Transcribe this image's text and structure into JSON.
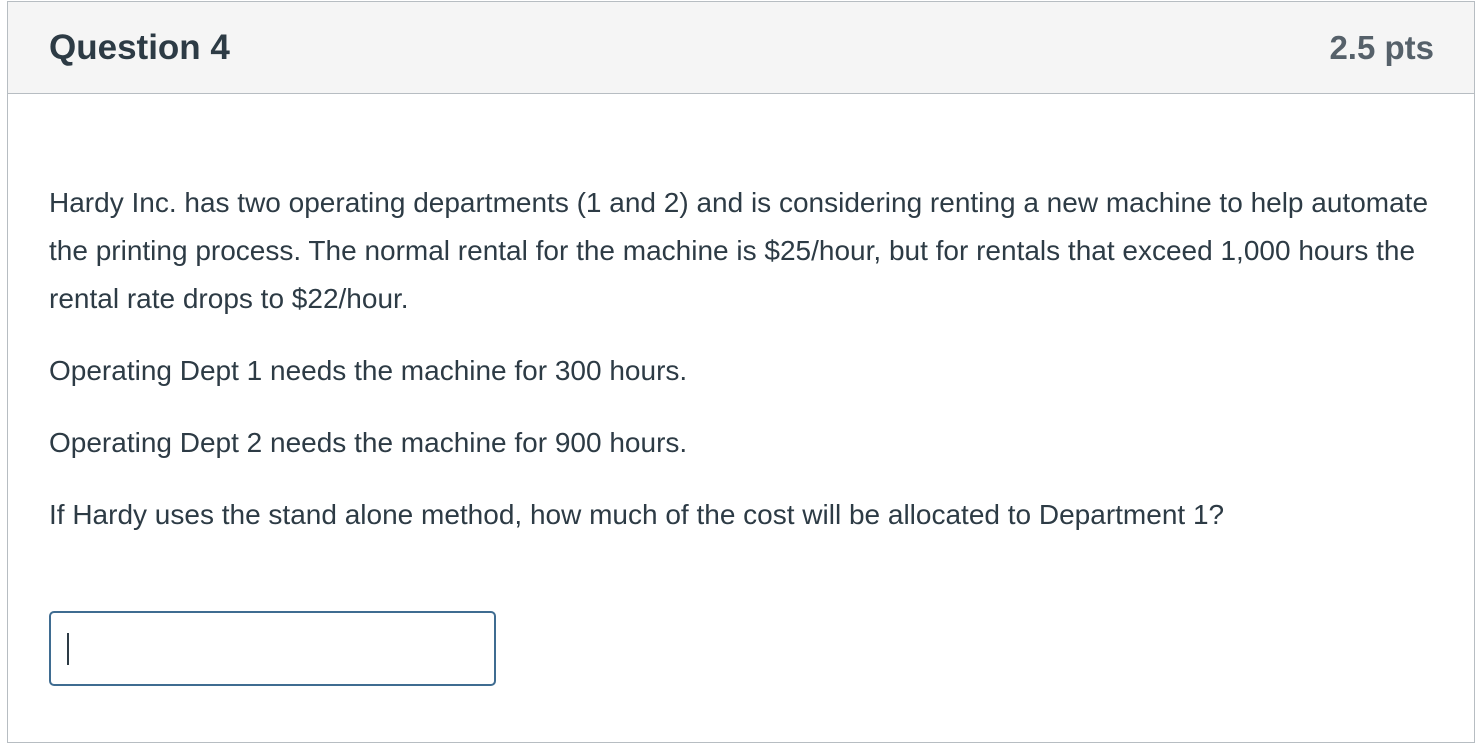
{
  "question": {
    "title": "Question 4",
    "points": "2.5 pts",
    "paragraphs": [
      "Hardy Inc. has two operating departments (1 and 2) and is considering renting a new machine to help automate the printing process. The normal rental for the machine is $25/hour, but for rentals that exceed 1,000 hours the rental rate drops to $22/hour.",
      "Operating Dept 1 needs the machine for 300 hours.",
      "Operating Dept 2 needs the machine for 900 hours.",
      "If Hardy uses the stand alone method, how much of the cost will be allocated to Department 1?"
    ],
    "answer": {
      "value": "",
      "placeholder": ""
    }
  },
  "colors": {
    "header_bg": "#f5f5f5",
    "border": "#b7bdc2",
    "text": "#2d3b45",
    "points_text": "#56616a",
    "input_border_focus": "#3f6c91"
  }
}
